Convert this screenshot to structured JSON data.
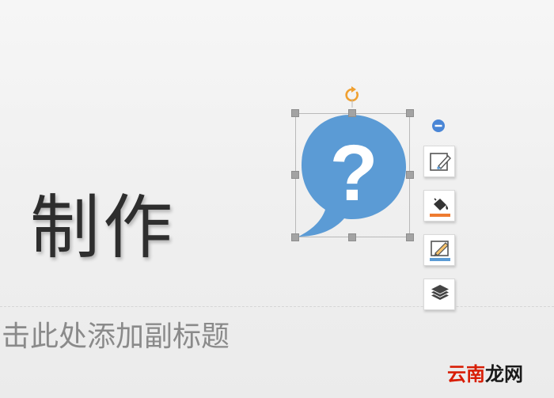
{
  "slide": {
    "title": "制作",
    "subtitle_placeholder": "击此处添加副标题",
    "background_color": "#f0f0f0"
  },
  "selected_shape": {
    "kind": "speech-bubble",
    "glyph": "?",
    "fill_color": "#5b9bd5",
    "selected": true
  },
  "toolbar": {
    "collapse_icon": "minus-circle-icon",
    "buttons": [
      {
        "name": "shape-style-button",
        "icon": "brush-edit-icon"
      },
      {
        "name": "fill-color-button",
        "icon": "paint-bucket-icon",
        "accent": "#ee7b30"
      },
      {
        "name": "outline-button",
        "icon": "pencil-outline-icon",
        "accent": "#5b9bd5"
      },
      {
        "name": "arrange-button",
        "icon": "layers-icon"
      }
    ]
  },
  "watermark": {
    "part1": "云南",
    "part2": "龙网",
    "color_part1": "#d81e06",
    "color_part2": "#1a1a1a"
  },
  "accent_colors": {
    "rotate": "#f0a030",
    "handle": "#a3a3a3"
  }
}
